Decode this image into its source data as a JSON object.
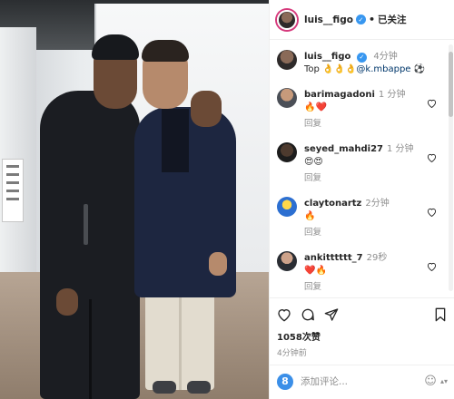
{
  "post": {
    "author": "luis__figo",
    "follow_status": "已关注",
    "separator": "•",
    "caption": {
      "username": "luis__figo",
      "time": "4分钟",
      "text_prefix": "Top ",
      "emojis": "👌👌👌",
      "mention": "@k.mbappe",
      "text_suffix": " ⚽"
    },
    "comments": [
      {
        "username": "barimagadoni",
        "time": "1 分钟",
        "text": "🔥❤️",
        "reply_label": "回复"
      },
      {
        "username": "seyed_mahdi27",
        "time": "1 分钟",
        "text": "😍😍",
        "reply_label": "回复"
      },
      {
        "username": "claytonartz",
        "time": "2分钟",
        "text": "🔥",
        "reply_label": "回复"
      },
      {
        "username": "ankitttttt_7",
        "time": "29秒",
        "text": "❤️🔥",
        "reply_label": "回复"
      }
    ],
    "likes": "1058次赞",
    "time_ago": "4分钟前",
    "add_comment_placeholder": "添加评论...",
    "emoji_icon": "☺",
    "colors": {
      "verified": "#3897f0",
      "story_ring": "#d63a7c",
      "mention": "#00376b",
      "add_icon": "#3b8fe8"
    }
  }
}
